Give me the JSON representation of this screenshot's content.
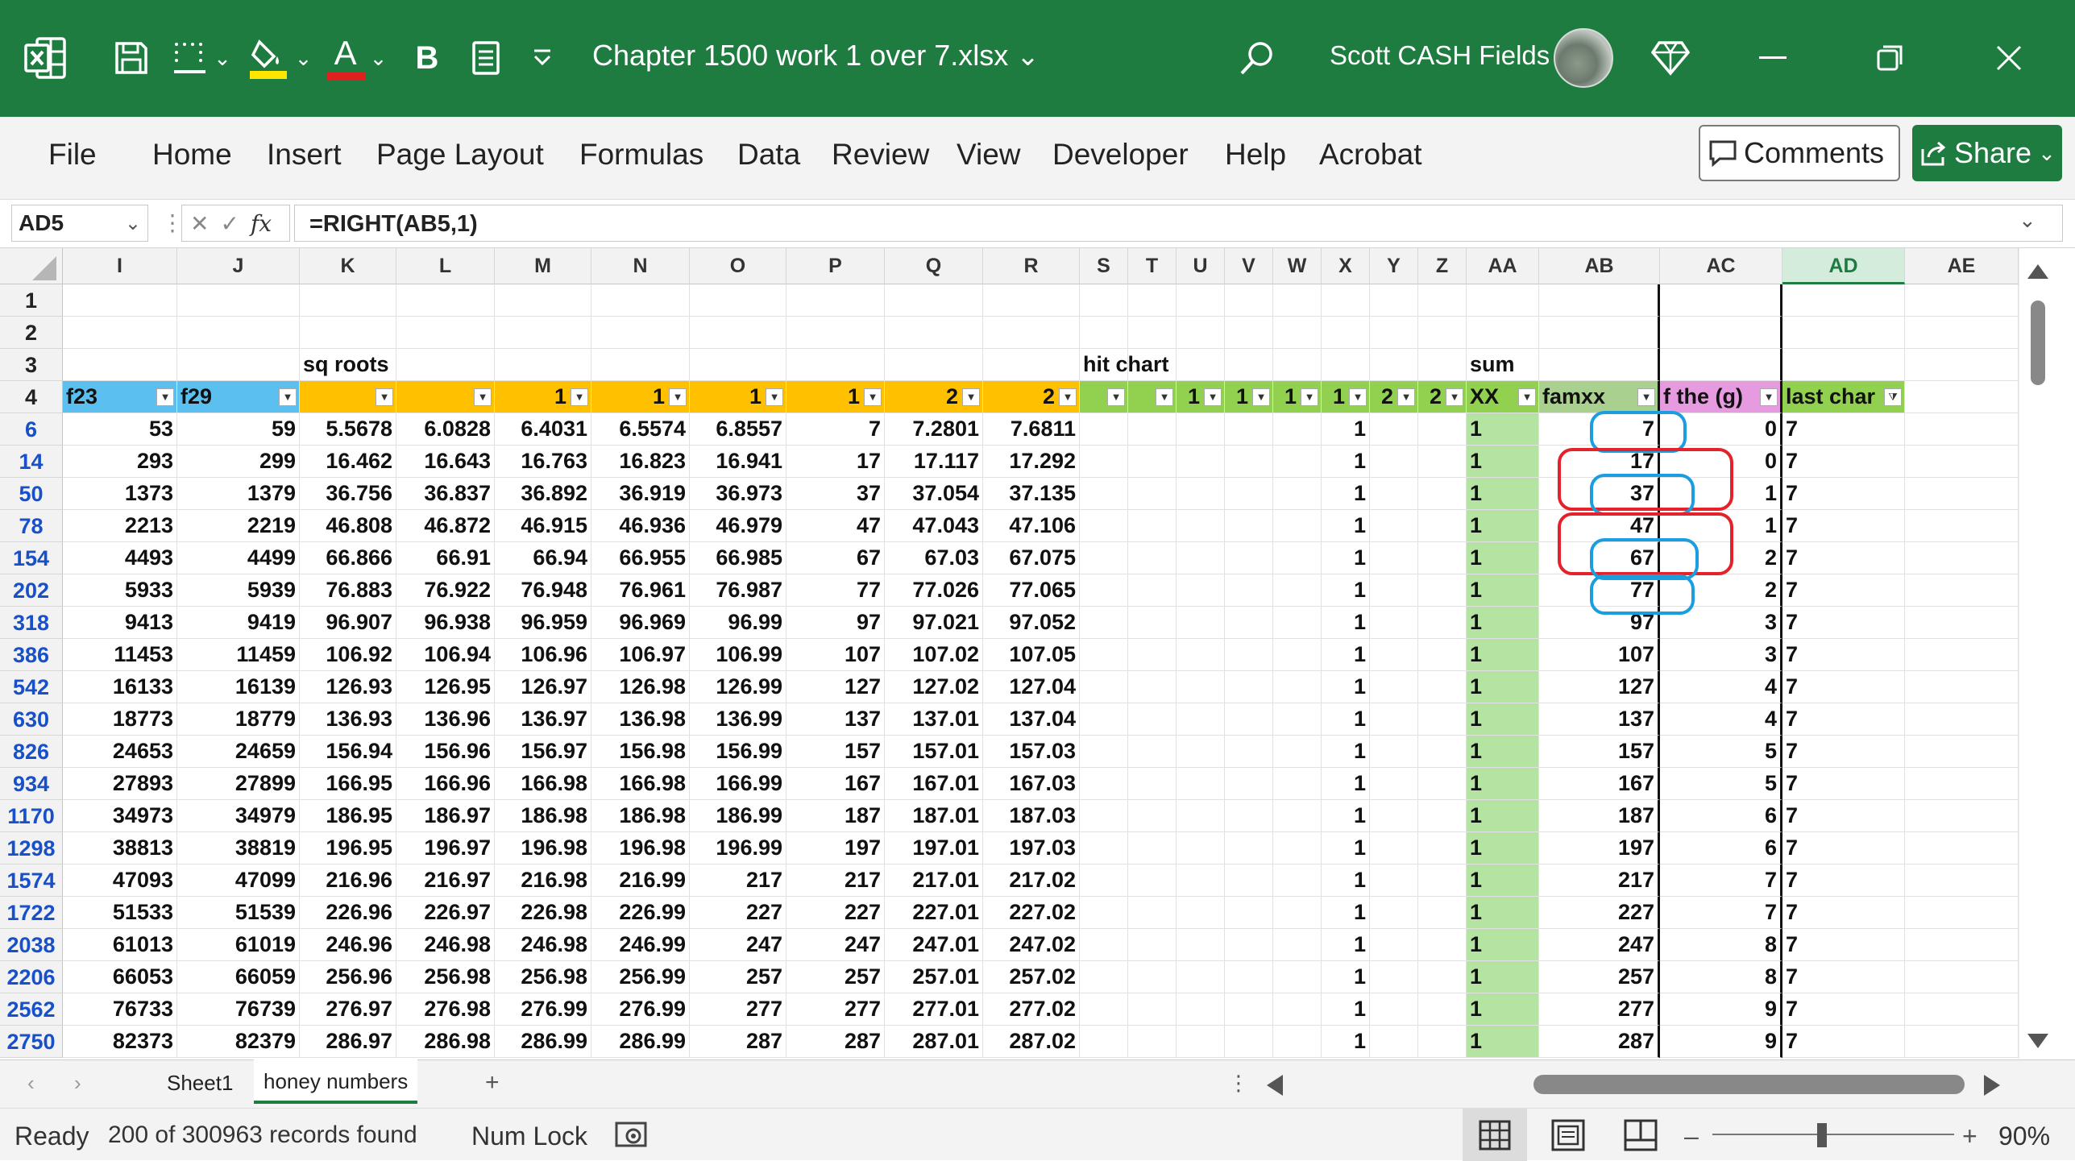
{
  "title_bar": {
    "document_title": "Chapter 1500 work 1 over 7.xlsx",
    "user_name": "Scott CASH Fields",
    "icons": [
      "excel-icon",
      "save-icon",
      "borders-icon",
      "fill-color-icon",
      "font-color-icon",
      "bold-icon",
      "form-icon",
      "customize-icon",
      "search-icon",
      "diamond-icon",
      "minimize-icon",
      "restore-icon",
      "close-icon"
    ],
    "bold_label": "B",
    "font_color_label": "A",
    "accent": "#1f7c41"
  },
  "ribbon": {
    "menu": [
      "File",
      "Home",
      "Insert",
      "Page Layout",
      "Formulas",
      "Data",
      "Review",
      "View",
      "Developer",
      "Help",
      "Acrobat"
    ],
    "comments_label": "Comments",
    "share_label": "Share"
  },
  "formula_bar": {
    "name_box": "AD5",
    "fx_label": "fx",
    "formula": "=RIGHT(AB5,1)"
  },
  "sheet": {
    "columns": [
      "I",
      "J",
      "K",
      "L",
      "M",
      "N",
      "O",
      "P",
      "Q",
      "R",
      "S",
      "T",
      "U",
      "V",
      "W",
      "X",
      "Y",
      "Z",
      "AA",
      "AB",
      "AC",
      "AD",
      "AE"
    ],
    "selected_column": "AD",
    "row_numbers": [
      "1",
      "2",
      "3",
      "4",
      "6",
      "14",
      "50",
      "78",
      "154",
      "202",
      "318",
      "386",
      "542",
      "630",
      "826",
      "934",
      "1170",
      "1298",
      "1574",
      "1722",
      "2038",
      "2206",
      "2562",
      "2750"
    ],
    "row3": {
      "K": "sq roots",
      "S": "hit chart",
      "AA": "sum"
    },
    "header_row": [
      "f23",
      "f29",
      "",
      "",
      "1",
      "1",
      "1",
      "1",
      "2",
      "2",
      "",
      "",
      "1",
      "1",
      "1",
      "1",
      "2",
      "2",
      "XX",
      "famxx",
      "f the (g)",
      "last char",
      ""
    ],
    "data_rows": [
      [
        "53",
        "59",
        "5.5678",
        "6.0828",
        "6.4031",
        "6.5574",
        "6.8557",
        "7",
        "7.2801",
        "7.6811",
        "",
        "",
        "",
        "",
        "",
        "1",
        "",
        "",
        "1",
        "7",
        "0",
        "7"
      ],
      [
        "293",
        "299",
        "16.462",
        "16.643",
        "16.763",
        "16.823",
        "16.941",
        "17",
        "17.117",
        "17.292",
        "",
        "",
        "",
        "",
        "",
        "1",
        "",
        "",
        "1",
        "17",
        "0",
        "7"
      ],
      [
        "1373",
        "1379",
        "36.756",
        "36.837",
        "36.892",
        "36.919",
        "36.973",
        "37",
        "37.054",
        "37.135",
        "",
        "",
        "",
        "",
        "",
        "1",
        "",
        "",
        "1",
        "37",
        "1",
        "7"
      ],
      [
        "2213",
        "2219",
        "46.808",
        "46.872",
        "46.915",
        "46.936",
        "46.979",
        "47",
        "47.043",
        "47.106",
        "",
        "",
        "",
        "",
        "",
        "1",
        "",
        "",
        "1",
        "47",
        "1",
        "7"
      ],
      [
        "4493",
        "4499",
        "66.866",
        "66.91",
        "66.94",
        "66.955",
        "66.985",
        "67",
        "67.03",
        "67.075",
        "",
        "",
        "",
        "",
        "",
        "1",
        "",
        "",
        "1",
        "67",
        "2",
        "7"
      ],
      [
        "5933",
        "5939",
        "76.883",
        "76.922",
        "76.948",
        "76.961",
        "76.987",
        "77",
        "77.026",
        "77.065",
        "",
        "",
        "",
        "",
        "",
        "1",
        "",
        "",
        "1",
        "77",
        "2",
        "7"
      ],
      [
        "9413",
        "9419",
        "96.907",
        "96.938",
        "96.959",
        "96.969",
        "96.99",
        "97",
        "97.021",
        "97.052",
        "",
        "",
        "",
        "",
        "",
        "1",
        "",
        "",
        "1",
        "97",
        "3",
        "7"
      ],
      [
        "11453",
        "11459",
        "106.92",
        "106.94",
        "106.96",
        "106.97",
        "106.99",
        "107",
        "107.02",
        "107.05",
        "",
        "",
        "",
        "",
        "",
        "1",
        "",
        "",
        "1",
        "107",
        "3",
        "7"
      ],
      [
        "16133",
        "16139",
        "126.93",
        "126.95",
        "126.97",
        "126.98",
        "126.99",
        "127",
        "127.02",
        "127.04",
        "",
        "",
        "",
        "",
        "",
        "1",
        "",
        "",
        "1",
        "127",
        "4",
        "7"
      ],
      [
        "18773",
        "18779",
        "136.93",
        "136.96",
        "136.97",
        "136.98",
        "136.99",
        "137",
        "137.01",
        "137.04",
        "",
        "",
        "",
        "",
        "",
        "1",
        "",
        "",
        "1",
        "137",
        "4",
        "7"
      ],
      [
        "24653",
        "24659",
        "156.94",
        "156.96",
        "156.97",
        "156.98",
        "156.99",
        "157",
        "157.01",
        "157.03",
        "",
        "",
        "",
        "",
        "",
        "1",
        "",
        "",
        "1",
        "157",
        "5",
        "7"
      ],
      [
        "27893",
        "27899",
        "166.95",
        "166.96",
        "166.98",
        "166.98",
        "166.99",
        "167",
        "167.01",
        "167.03",
        "",
        "",
        "",
        "",
        "",
        "1",
        "",
        "",
        "1",
        "167",
        "5",
        "7"
      ],
      [
        "34973",
        "34979",
        "186.95",
        "186.97",
        "186.98",
        "186.98",
        "186.99",
        "187",
        "187.01",
        "187.03",
        "",
        "",
        "",
        "",
        "",
        "1",
        "",
        "",
        "1",
        "187",
        "6",
        "7"
      ],
      [
        "38813",
        "38819",
        "196.95",
        "196.97",
        "196.98",
        "196.98",
        "196.99",
        "197",
        "197.01",
        "197.03",
        "",
        "",
        "",
        "",
        "",
        "1",
        "",
        "",
        "1",
        "197",
        "6",
        "7"
      ],
      [
        "47093",
        "47099",
        "216.96",
        "216.97",
        "216.98",
        "216.99",
        "217",
        "217",
        "217.01",
        "217.02",
        "",
        "",
        "",
        "",
        "",
        "1",
        "",
        "",
        "1",
        "217",
        "7",
        "7"
      ],
      [
        "51533",
        "51539",
        "226.96",
        "226.97",
        "226.98",
        "226.99",
        "227",
        "227",
        "227.01",
        "227.02",
        "",
        "",
        "",
        "",
        "",
        "1",
        "",
        "",
        "1",
        "227",
        "7",
        "7"
      ],
      [
        "61013",
        "61019",
        "246.96",
        "246.98",
        "246.98",
        "246.99",
        "247",
        "247",
        "247.01",
        "247.02",
        "",
        "",
        "",
        "",
        "",
        "1",
        "",
        "",
        "1",
        "247",
        "8",
        "7"
      ],
      [
        "66053",
        "66059",
        "256.96",
        "256.98",
        "256.98",
        "256.99",
        "257",
        "257",
        "257.01",
        "257.02",
        "",
        "",
        "",
        "",
        "",
        "1",
        "",
        "",
        "1",
        "257",
        "8",
        "7"
      ],
      [
        "76733",
        "76739",
        "276.97",
        "276.98",
        "276.99",
        "276.99",
        "277",
        "277",
        "277.01",
        "277.02",
        "",
        "",
        "",
        "",
        "",
        "1",
        "",
        "",
        "1",
        "277",
        "9",
        "7"
      ],
      [
        "82373",
        "82379",
        "286.97",
        "286.98",
        "286.99",
        "286.99",
        "287",
        "287",
        "287.01",
        "287.02",
        "",
        "",
        "",
        "",
        "",
        "1",
        "",
        "",
        "1",
        "287",
        "9",
        "7"
      ]
    ],
    "header_colors": {
      "f23": "#5bc0f0",
      "f29": "#5bc0f0",
      "sq": "#ffc000",
      "hit": "#92d050",
      "XX": "#92d050",
      "famxx": "#a9d08e",
      "fthe": "#e69ae0",
      "last": "#92d050",
      "aa_fill": "#b4e3a2"
    }
  },
  "tabs": {
    "sheets": [
      "Sheet1",
      "honey numbers"
    ],
    "active": "honey numbers",
    "add_label": "+"
  },
  "status": {
    "ready": "Ready",
    "records": "200 of 300963 records found",
    "num_lock": "Num Lock",
    "zoom": "90%"
  }
}
